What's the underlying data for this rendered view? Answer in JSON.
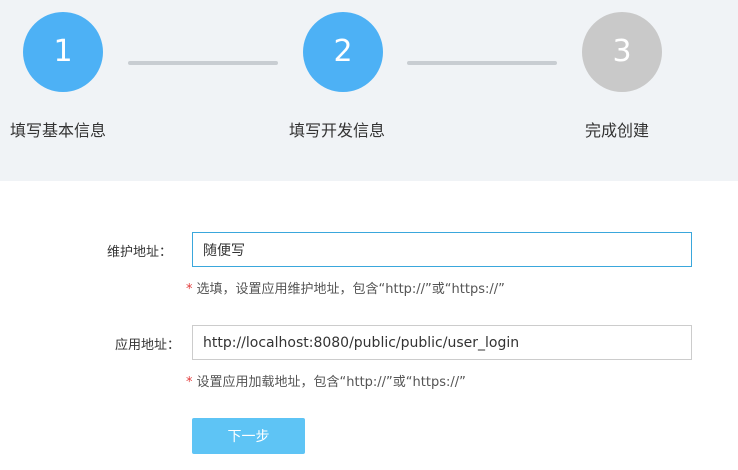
{
  "steps": [
    {
      "number": "1",
      "label": "填写基本信息",
      "state": "active"
    },
    {
      "number": "2",
      "label": "填写开发信息",
      "state": "active"
    },
    {
      "number": "3",
      "label": "完成创建",
      "state": "inactive"
    }
  ],
  "colors": {
    "step_active": "#4db1f5",
    "step_inactive": "#c9c9c9",
    "required_star": "#e23a3a",
    "button": "#5ec4f5"
  },
  "form": {
    "maintenance": {
      "label": "维护地址：",
      "value": "随便写",
      "hint_star": "*",
      "hint": "选填，设置应用维护地址，包含“http://”或“https://”"
    },
    "app_url": {
      "label": "应用地址：",
      "value": "http://localhost:8080/public/public/user_login",
      "hint_star": "*",
      "hint": "设置应用加载地址，包含“http://”或“https://”"
    },
    "next_label": "下一步"
  }
}
